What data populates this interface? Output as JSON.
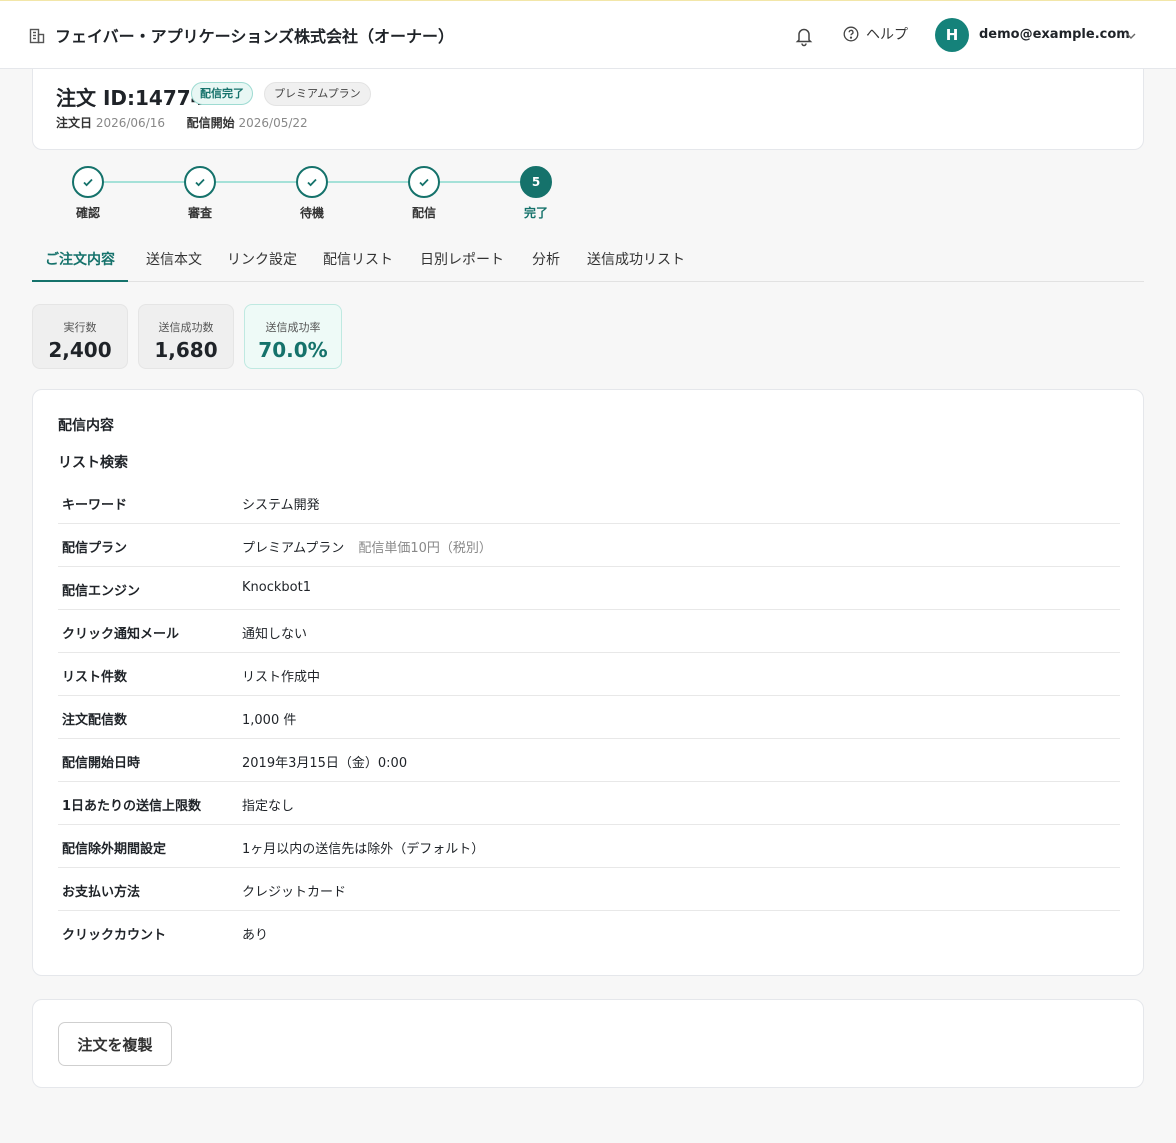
{
  "header": {
    "company_name": "フェイバー・アプリケーションズ株式会社（オーナー）",
    "help_label": "ヘルプ",
    "avatar_initial": "H",
    "user_email": "demo@example.com"
  },
  "order": {
    "title": "注文 ID:14774",
    "status_badge": "配信完了",
    "plan_badge": "プレミアムプラン",
    "order_date_label": "注文日",
    "order_date": "2026/06/16",
    "start_date_label": "配信開始",
    "start_date": "2026/05/22"
  },
  "stepper": {
    "steps": [
      {
        "label": "確認",
        "state": "done"
      },
      {
        "label": "審査",
        "state": "done"
      },
      {
        "label": "待機",
        "state": "done"
      },
      {
        "label": "配信",
        "state": "done"
      },
      {
        "label": "完了",
        "state": "active",
        "number": "5"
      }
    ]
  },
  "tabs": [
    {
      "label": "ご注文内容",
      "active": true
    },
    {
      "label": "送信本文",
      "active": false
    },
    {
      "label": "リンク設定",
      "active": false
    },
    {
      "label": "配信リスト",
      "active": false
    },
    {
      "label": "日別レポート",
      "active": false
    },
    {
      "label": "分析",
      "active": false
    },
    {
      "label": "送信成功リスト",
      "active": false
    }
  ],
  "stats": [
    {
      "label": "実行数",
      "value": "2,400"
    },
    {
      "label": "送信成功数",
      "value": "1,680"
    },
    {
      "label": "送信成功率",
      "value": "70.0%"
    }
  ],
  "details": {
    "section_title": "配信内容",
    "sub_title": "リスト検索",
    "rows": [
      {
        "label": "キーワード",
        "value": "システム開発"
      },
      {
        "label": "配信プラン",
        "value": "プレミアムプラン",
        "note": "配信単価10円（税別）"
      },
      {
        "label": "配信エンジン",
        "value": "Knockbot1"
      },
      {
        "label": "クリック通知メール",
        "value": "通知しない"
      },
      {
        "label": "リスト件数",
        "value": "リスト作成中"
      },
      {
        "label": "注文配信数",
        "value": "1,000 件"
      },
      {
        "label": "配信開始日時",
        "value": "2019年3月15日（金）0:00"
      },
      {
        "label": "1日あたりの送信上限数",
        "value": "指定なし"
      },
      {
        "label": "配信除外期間設定",
        "value": "1ヶ月以内の送信先は除外（デフォルト）"
      },
      {
        "label": "お支払い方法",
        "value": "クレジットカード"
      },
      {
        "label": "クリックカウント",
        "value": "あり"
      }
    ]
  },
  "actions": {
    "duplicate_label": "注文を複製"
  },
  "colors": {
    "accent": "#15726b",
    "avatar": "#15827a"
  }
}
